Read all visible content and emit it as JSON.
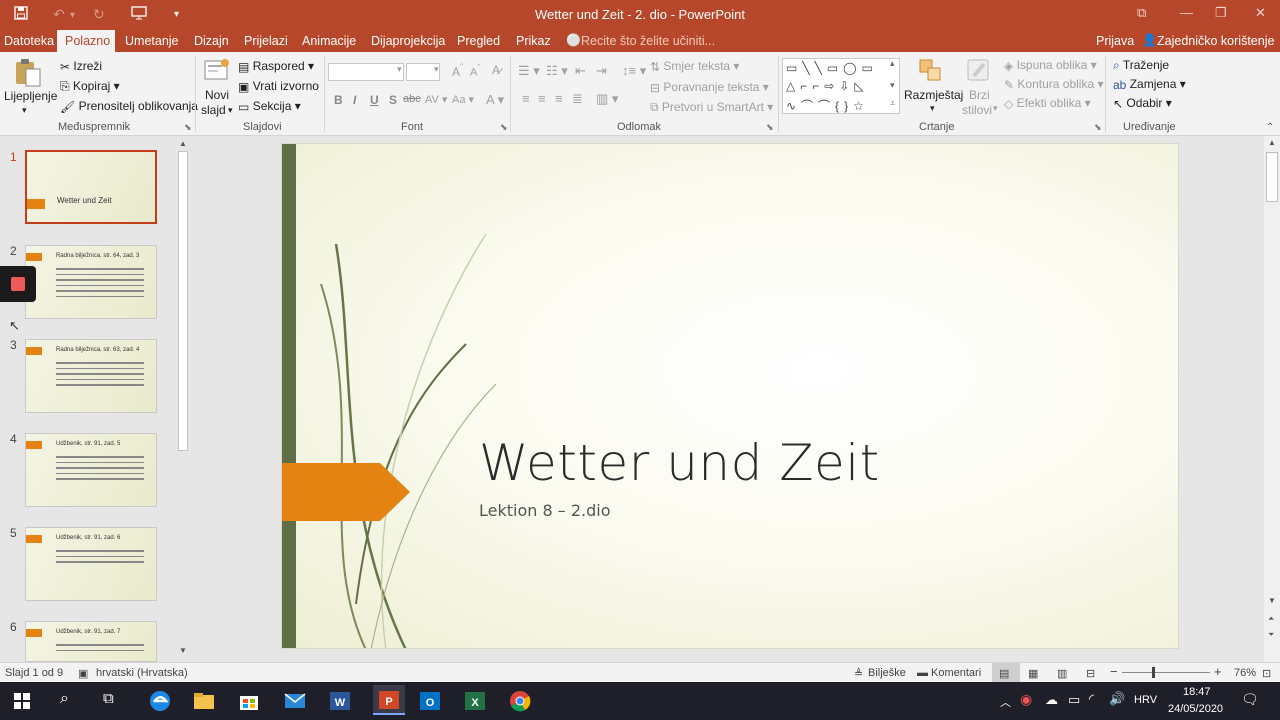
{
  "titlebar": {
    "title": "Wetter und Zeit - 2. dio - PowerPoint"
  },
  "tabs": {
    "items": [
      "Datoteka",
      "Umetanje",
      "Dizajn",
      "Prijelazi",
      "Animacije",
      "Dijaprojekcija",
      "Pregled",
      "Prikaz"
    ],
    "active": "Polazno",
    "tell_me": "Recite što želite učiniti...",
    "signin": "Prijava",
    "share": "Zajedničko korištenje"
  },
  "ribbon": {
    "clipboard": {
      "paste": "Lijepljenje",
      "cut": "Izreži",
      "copy": "Kopiraj",
      "format_painter": "Prenositelj oblikovanja",
      "label": "Međuspremnik"
    },
    "slides": {
      "new_slide_1": "Novi",
      "new_slide_2": "slajd",
      "layout": "Raspored",
      "reset": "Vrati izvorno",
      "section": "Sekcija",
      "label": "Slajdovi"
    },
    "font": {
      "label": "Font",
      "bold": "B",
      "italic": "I",
      "underline": "U",
      "strike": "S",
      "shadow": "abc"
    },
    "paragraph": {
      "text_direction": "Smjer teksta",
      "align_text": "Poravnanje teksta",
      "smartart": "Pretvori u SmartArt",
      "label": "Odlomak"
    },
    "drawing": {
      "arrange": "Razmještaj",
      "quick_styles_1": "Brzi",
      "quick_styles_2": "stilovi",
      "shape_fill": "Ispuna oblika",
      "shape_outline": "Kontura oblika",
      "shape_effects": "Efekti oblika",
      "label": "Crtanje"
    },
    "editing": {
      "find": "Traženje",
      "replace": "Zamjena",
      "select": "Odabir",
      "label": "Uređivanje"
    }
  },
  "thumbnails": [
    {
      "num": "1",
      "title": "Wetter und Zeit"
    },
    {
      "num": "2",
      "title": "Radna bilježnica, str. 64, zad. 3"
    },
    {
      "num": "3",
      "title": "Radna bilježnica, str. 63, zad. 4"
    },
    {
      "num": "4",
      "title": "Udžbenik, str. 91, zad. 5"
    },
    {
      "num": "5",
      "title": "Udžbenik, str. 91, zad. 6"
    },
    {
      "num": "6",
      "title": "Udžbenik, str. 91, zad. 7"
    }
  ],
  "slide": {
    "title": "Wetter und Zeit",
    "subtitle": "Lektion 8 – 2.dio"
  },
  "statusbar": {
    "slide_count": "Slajd 1 od 9",
    "language": "hrvatski (Hrvatska)",
    "notes": "Bilješke",
    "comments": "Komentari",
    "zoom": "76%"
  },
  "taskbar": {
    "language": "HRV",
    "time": "18:47",
    "date": "24/05/2020"
  },
  "colors": {
    "accent": "#b7472a",
    "slide_bar": "#5f7046",
    "slide_arrow": "#e48312"
  }
}
